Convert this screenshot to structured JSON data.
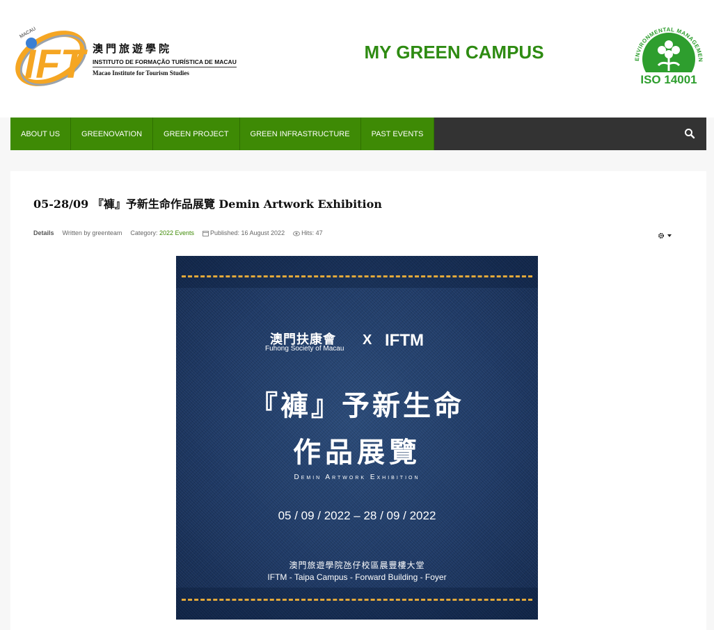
{
  "header": {
    "logo": {
      "mark_text": "IFT",
      "ring_text": "MACAU",
      "name_zh": "澳門旅遊學院",
      "name_pt": "INSTITUTO DE FORMAÇÃO TURÍSTICA DE MACAU",
      "name_en": "Macao Institute for Tourism Studies"
    },
    "site_title": "MY GREEN CAMPUS",
    "iso_badge": {
      "ring_text": "ENVIRONMENTAL MANAGEMENT SYSTEM",
      "label": "ISO 14001",
      "color": "#2e9e2e"
    }
  },
  "nav": {
    "items": [
      {
        "label": "ABOUT US"
      },
      {
        "label": "GREENOVATION"
      },
      {
        "label": "GREEN PROJECT"
      },
      {
        "label": "GREEN INFRASTRUCTURE"
      },
      {
        "label": "PAST EVENTS"
      }
    ],
    "search_icon": "search-icon",
    "colors": {
      "item_bg": "#3e8a05",
      "bar_bg": "#333333"
    }
  },
  "article": {
    "title": "05-28/09 『褲』予新生命作品展覽 Demin Artwork Exhibition",
    "meta": {
      "details_label": "Details",
      "written_by": "Written by greenteam",
      "category_prefix": "Category:",
      "category": "2022 Events",
      "published": "Published: 16 August 2022",
      "hits": "Hits: 47"
    },
    "tools_icon": "gear-icon",
    "poster": {
      "org_zh": "澳門扶康會",
      "org_en": "Fuhong Society of Macau",
      "x": "X",
      "partner": "IFTM",
      "title_line1": "『褲』予新生命",
      "title_line2": "作品展覽",
      "subtitle": "Demin Artwork Exhibition",
      "dates": "05 / 09 / 2022 – 28 / 09 / 2022",
      "venue_zh": "澳門旅遊學院氹仔校區晨豐樓大堂",
      "venue_en": "IFTM - Taipa Campus - Forward Building - Foyer"
    }
  }
}
